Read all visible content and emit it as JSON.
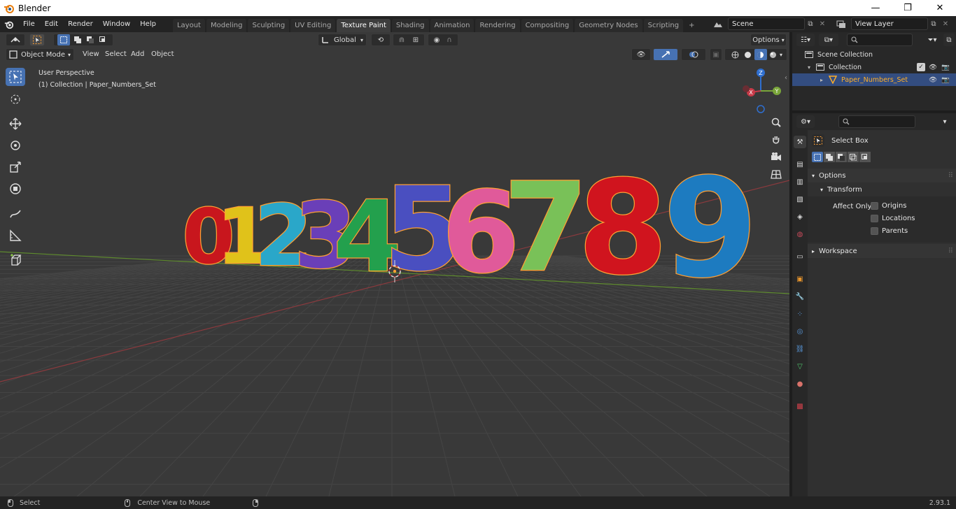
{
  "window": {
    "title": "Blender"
  },
  "menu": [
    "File",
    "Edit",
    "Render",
    "Window",
    "Help"
  ],
  "workspaces": [
    "Layout",
    "Modeling",
    "Sculpting",
    "UV Editing",
    "Texture Paint",
    "Shading",
    "Animation",
    "Rendering",
    "Compositing",
    "Geometry Nodes",
    "Scripting"
  ],
  "active_workspace": "Texture Paint",
  "scene": {
    "name": "Scene",
    "view_layer": "View Layer"
  },
  "toolbar_header": {
    "orientation": "Global",
    "options": "Options"
  },
  "viewport": {
    "mode": "Object Mode",
    "menus": [
      "View",
      "Select",
      "Add",
      "Object"
    ],
    "overlay_line1": "User Perspective",
    "overlay_line2": "(1) Collection | Paper_Numbers_Set",
    "gizmo": {
      "x": "X",
      "y": "Y",
      "z": "Z"
    },
    "digits": [
      "0",
      "1",
      "2",
      "3",
      "4",
      "5",
      "6",
      "7",
      "8",
      "9"
    ],
    "colors": {
      "bg": "#393939",
      "grid": "#454545",
      "x_axis": "#8a3a3e",
      "y_axis": "#5e8a2e",
      "outline": "#ffa033"
    }
  },
  "outliner": {
    "scene_collection": "Scene Collection",
    "collection": "Collection",
    "object": "Paper_Numbers_Set"
  },
  "properties": {
    "tool_name": "Select Box",
    "options_label": "Options",
    "transform_label": "Transform",
    "affect_only": "Affect Only",
    "origins": "Origins",
    "locations": "Locations",
    "parents": "Parents",
    "workspace_label": "Workspace"
  },
  "status": {
    "left": "Select",
    "middle": "Center View to Mouse",
    "version": "2.93.1"
  }
}
